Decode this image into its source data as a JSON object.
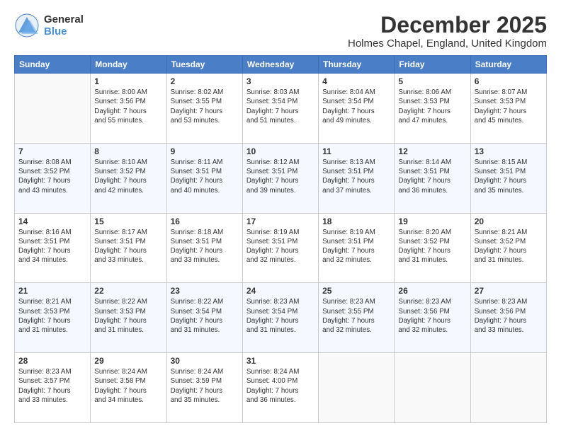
{
  "header": {
    "logo_line1": "General",
    "logo_line2": "Blue",
    "title": "December 2025",
    "subtitle": "Holmes Chapel, England, United Kingdom"
  },
  "weekdays": [
    "Sunday",
    "Monday",
    "Tuesday",
    "Wednesday",
    "Thursday",
    "Friday",
    "Saturday"
  ],
  "weeks": [
    [
      {
        "day": "",
        "info": ""
      },
      {
        "day": "1",
        "info": "Sunrise: 8:00 AM\nSunset: 3:56 PM\nDaylight: 7 hours\nand 55 minutes."
      },
      {
        "day": "2",
        "info": "Sunrise: 8:02 AM\nSunset: 3:55 PM\nDaylight: 7 hours\nand 53 minutes."
      },
      {
        "day": "3",
        "info": "Sunrise: 8:03 AM\nSunset: 3:54 PM\nDaylight: 7 hours\nand 51 minutes."
      },
      {
        "day": "4",
        "info": "Sunrise: 8:04 AM\nSunset: 3:54 PM\nDaylight: 7 hours\nand 49 minutes."
      },
      {
        "day": "5",
        "info": "Sunrise: 8:06 AM\nSunset: 3:53 PM\nDaylight: 7 hours\nand 47 minutes."
      },
      {
        "day": "6",
        "info": "Sunrise: 8:07 AM\nSunset: 3:53 PM\nDaylight: 7 hours\nand 45 minutes."
      }
    ],
    [
      {
        "day": "7",
        "info": "Sunrise: 8:08 AM\nSunset: 3:52 PM\nDaylight: 7 hours\nand 43 minutes."
      },
      {
        "day": "8",
        "info": "Sunrise: 8:10 AM\nSunset: 3:52 PM\nDaylight: 7 hours\nand 42 minutes."
      },
      {
        "day": "9",
        "info": "Sunrise: 8:11 AM\nSunset: 3:51 PM\nDaylight: 7 hours\nand 40 minutes."
      },
      {
        "day": "10",
        "info": "Sunrise: 8:12 AM\nSunset: 3:51 PM\nDaylight: 7 hours\nand 39 minutes."
      },
      {
        "day": "11",
        "info": "Sunrise: 8:13 AM\nSunset: 3:51 PM\nDaylight: 7 hours\nand 37 minutes."
      },
      {
        "day": "12",
        "info": "Sunrise: 8:14 AM\nSunset: 3:51 PM\nDaylight: 7 hours\nand 36 minutes."
      },
      {
        "day": "13",
        "info": "Sunrise: 8:15 AM\nSunset: 3:51 PM\nDaylight: 7 hours\nand 35 minutes."
      }
    ],
    [
      {
        "day": "14",
        "info": "Sunrise: 8:16 AM\nSunset: 3:51 PM\nDaylight: 7 hours\nand 34 minutes."
      },
      {
        "day": "15",
        "info": "Sunrise: 8:17 AM\nSunset: 3:51 PM\nDaylight: 7 hours\nand 33 minutes."
      },
      {
        "day": "16",
        "info": "Sunrise: 8:18 AM\nSunset: 3:51 PM\nDaylight: 7 hours\nand 33 minutes."
      },
      {
        "day": "17",
        "info": "Sunrise: 8:19 AM\nSunset: 3:51 PM\nDaylight: 7 hours\nand 32 minutes."
      },
      {
        "day": "18",
        "info": "Sunrise: 8:19 AM\nSunset: 3:51 PM\nDaylight: 7 hours\nand 32 minutes."
      },
      {
        "day": "19",
        "info": "Sunrise: 8:20 AM\nSunset: 3:52 PM\nDaylight: 7 hours\nand 31 minutes."
      },
      {
        "day": "20",
        "info": "Sunrise: 8:21 AM\nSunset: 3:52 PM\nDaylight: 7 hours\nand 31 minutes."
      }
    ],
    [
      {
        "day": "21",
        "info": "Sunrise: 8:21 AM\nSunset: 3:53 PM\nDaylight: 7 hours\nand 31 minutes."
      },
      {
        "day": "22",
        "info": "Sunrise: 8:22 AM\nSunset: 3:53 PM\nDaylight: 7 hours\nand 31 minutes."
      },
      {
        "day": "23",
        "info": "Sunrise: 8:22 AM\nSunset: 3:54 PM\nDaylight: 7 hours\nand 31 minutes."
      },
      {
        "day": "24",
        "info": "Sunrise: 8:23 AM\nSunset: 3:54 PM\nDaylight: 7 hours\nand 31 minutes."
      },
      {
        "day": "25",
        "info": "Sunrise: 8:23 AM\nSunset: 3:55 PM\nDaylight: 7 hours\nand 32 minutes."
      },
      {
        "day": "26",
        "info": "Sunrise: 8:23 AM\nSunset: 3:56 PM\nDaylight: 7 hours\nand 32 minutes."
      },
      {
        "day": "27",
        "info": "Sunrise: 8:23 AM\nSunset: 3:56 PM\nDaylight: 7 hours\nand 33 minutes."
      }
    ],
    [
      {
        "day": "28",
        "info": "Sunrise: 8:23 AM\nSunset: 3:57 PM\nDaylight: 7 hours\nand 33 minutes."
      },
      {
        "day": "29",
        "info": "Sunrise: 8:24 AM\nSunset: 3:58 PM\nDaylight: 7 hours\nand 34 minutes."
      },
      {
        "day": "30",
        "info": "Sunrise: 8:24 AM\nSunset: 3:59 PM\nDaylight: 7 hours\nand 35 minutes."
      },
      {
        "day": "31",
        "info": "Sunrise: 8:24 AM\nSunset: 4:00 PM\nDaylight: 7 hours\nand 36 minutes."
      },
      {
        "day": "",
        "info": ""
      },
      {
        "day": "",
        "info": ""
      },
      {
        "day": "",
        "info": ""
      }
    ]
  ]
}
